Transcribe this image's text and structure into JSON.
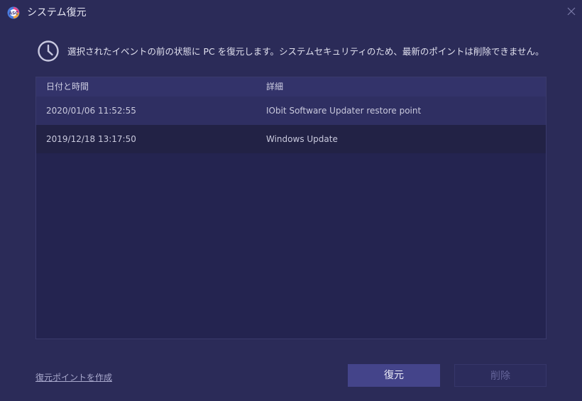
{
  "window": {
    "title": "システム復元",
    "icon": "app-logo-icon",
    "close_icon": "close-icon"
  },
  "info": {
    "icon": "clock-icon",
    "text": "選択されたイベントの前の状態に PC を復元します。システムセキュリティのため、最新のポイントは削除できません。"
  },
  "table": {
    "columns": [
      "日付と時間",
      "詳細"
    ],
    "rows": [
      {
        "date": "2020/01/06 11:52:55",
        "detail": "IObit Software Updater restore point",
        "selected": true
      },
      {
        "date": "2019/12/18 13:17:50",
        "detail": "Windows Update",
        "selected": false
      }
    ]
  },
  "footer": {
    "create_link": "復元ポイントを作成",
    "restore_button": "復元",
    "delete_button": "削除",
    "delete_disabled": true
  },
  "colors": {
    "background": "#2b2b58",
    "table_bg": "#242450",
    "header_bg": "#33336a",
    "selected_row": "#2f2f62",
    "restore_button": "#44448a"
  }
}
